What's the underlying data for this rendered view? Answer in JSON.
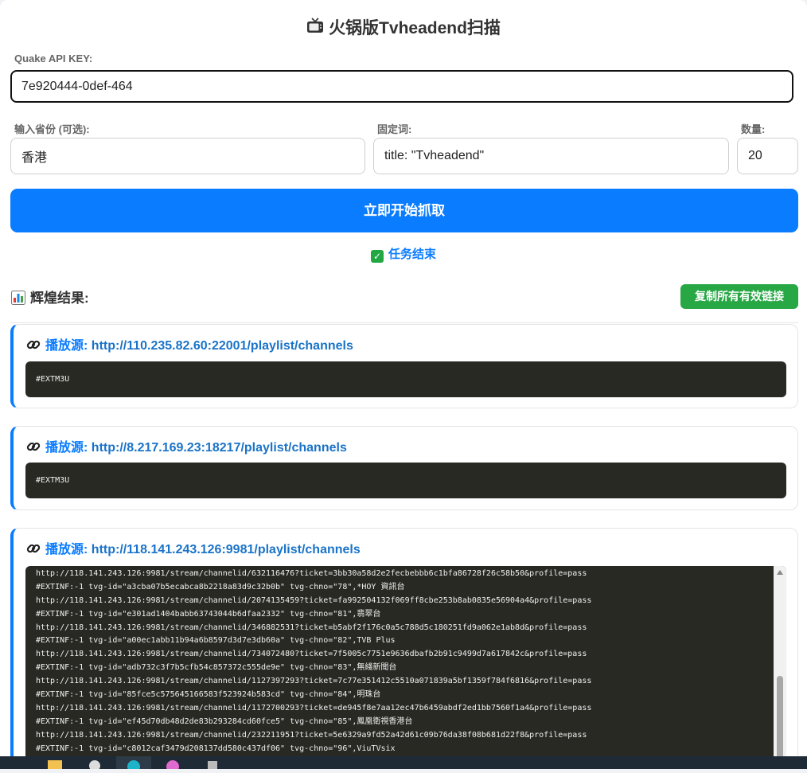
{
  "app_title": "火锅版Tvheadend扫描",
  "form": {
    "api_key_label": "Quake API KEY:",
    "api_key_value": "7e920444-0def-464",
    "province_label": "输入省份 (可选):",
    "province_value": "香港",
    "keyword_label": "固定词:",
    "keyword_value": "title: \"Tvheadend\"",
    "count_label": "数量:",
    "count_value": "20",
    "start_button": "立即开始抓取"
  },
  "status_text": "任务结束",
  "results": {
    "title": "辉煌结果:",
    "copy_button": "复制所有有效链接",
    "source_prefix": "播放源:",
    "cards": [
      {
        "url": "http://110.235.82.60:22001/playlist/channels",
        "lines": [
          "#EXTM3U"
        ]
      },
      {
        "url": "http://8.217.169.23:18217/playlist/channels",
        "lines": [
          "#EXTM3U"
        ]
      },
      {
        "url": "http://118.141.243.126:9981/playlist/channels",
        "lines": [
          "http://118.141.243.126:9981/stream/channelid/632116476?ticket=3bb30a58d2e2fecbebbb6c1bfa86728f26c58b50&profile=pass",
          "#EXTINF:-1 tvg-id=\"a3cba07b5ecabca8b2218a83d9c32b0b\" tvg-chno=\"78\",*HOY 資訊台",
          "http://118.141.243.126:9981/stream/channelid/2074135459?ticket=fa992504132f069ff8cbe253b8ab0835e56904a4&profile=pass",
          "#EXTINF:-1 tvg-id=\"e301ad1404babb63743044b6dfaa2332\" tvg-chno=\"81\",翡翠台",
          "http://118.141.243.126:9981/stream/channelid/346882531?ticket=b5abf2f176c0a5c788d5c180251fd9a062e1ab8d&profile=pass",
          "#EXTINF:-1 tvg-id=\"a00ec1abb11b94a6b8597d3d7e3db60a\" tvg-chno=\"82\",TVB Plus",
          "http://118.141.243.126:9981/stream/channelid/734072480?ticket=7f5005c7751e9636dbafb2b91c9499d7a617842c&profile=pass",
          "#EXTINF:-1 tvg-id=\"adb732c3f7b5cfb54c857372c555de9e\" tvg-chno=\"83\",無綫新聞台",
          "http://118.141.243.126:9981/stream/channelid/1127397293?ticket=7c77e351412c5510a071839a5bf1359f784f6816&profile=pass",
          "#EXTINF:-1 tvg-id=\"85fce5c575645166583f523924b583cd\" tvg-chno=\"84\",明珠台",
          "http://118.141.243.126:9981/stream/channelid/1172700293?ticket=de945f8e7aa12ec47b6459abdf2ed1bb7560f1a4&profile=pass",
          "#EXTINF:-1 tvg-id=\"ef45d70db48d2de83b293284cd60fce5\" tvg-chno=\"85\",鳳凰衛視香港台",
          "http://118.141.243.126:9981/stream/channelid/232211951?ticket=5e6329a9fd52a42d61c09b76da38f08b681d22f8&profile=pass",
          "#EXTINF:-1 tvg-id=\"c8012caf3479d208137dd580c437df06\" tvg-chno=\"96\",ViuTVsix"
        ]
      }
    ]
  },
  "icons": {
    "title": "tv-icon",
    "status": "check-mark-icon",
    "results": "bar-chart-icon",
    "source": "link-icon"
  },
  "colors": {
    "primary": "#0a7cff",
    "success": "#28a745",
    "code_bg": "#282923"
  }
}
